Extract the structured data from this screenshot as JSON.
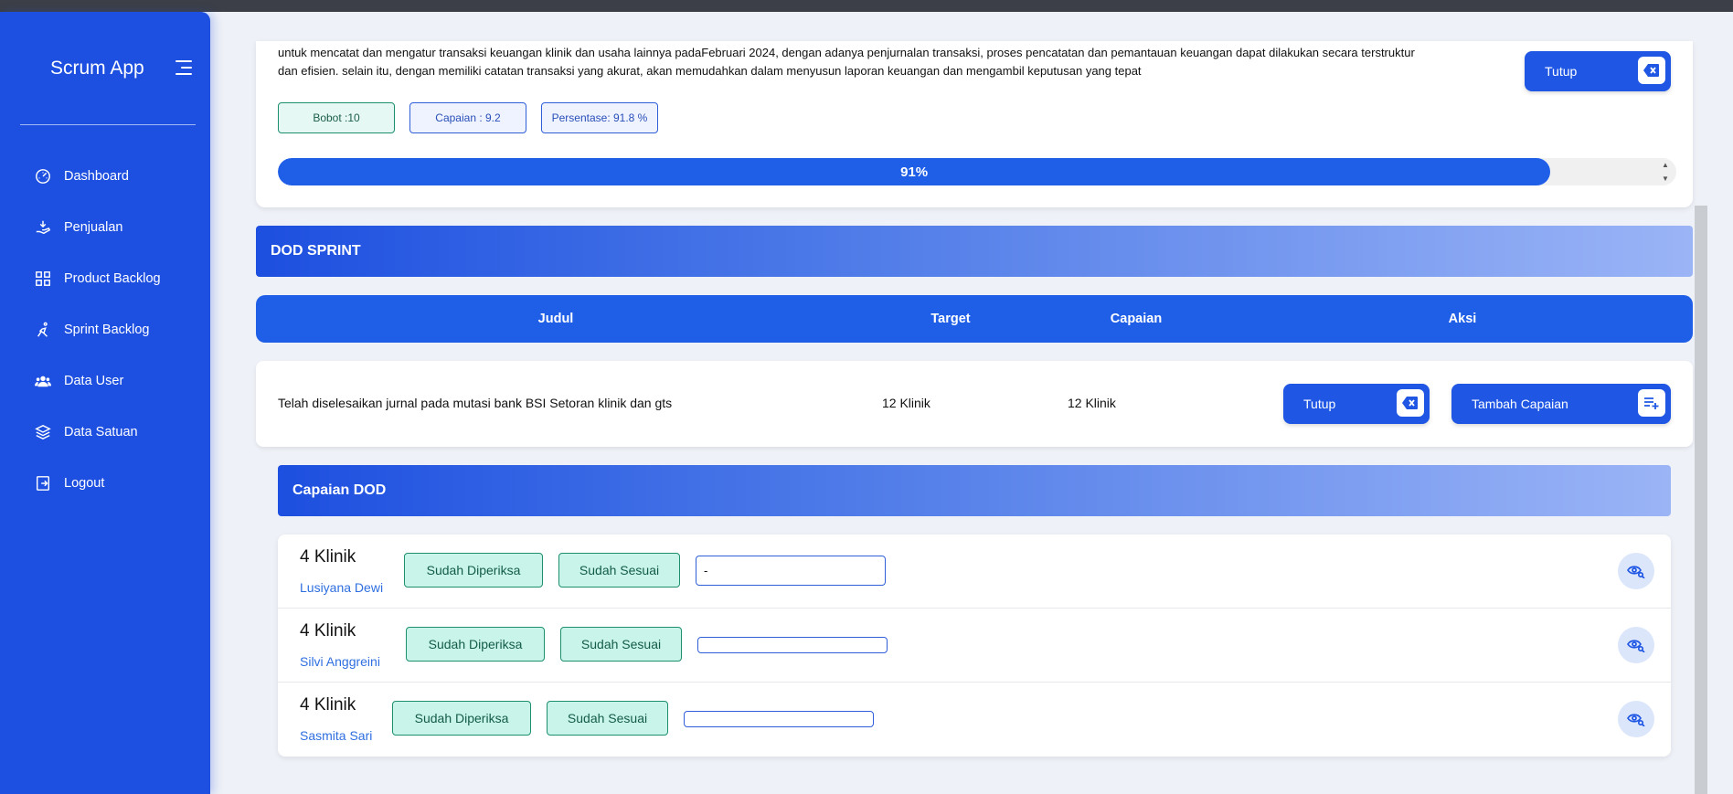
{
  "app": {
    "title": "Scrum App"
  },
  "sidebar": {
    "items": [
      {
        "label": "Dashboard",
        "icon": "gauge-icon"
      },
      {
        "label": "Penjualan",
        "icon": "hand-coin-icon"
      },
      {
        "label": "Product Backlog",
        "icon": "grid-icon"
      },
      {
        "label": "Sprint Backlog",
        "icon": "runner-icon"
      },
      {
        "label": "Data User",
        "icon": "users-icon"
      },
      {
        "label": "Data Satuan",
        "icon": "layers-icon"
      },
      {
        "label": "Logout",
        "icon": "logout-icon"
      }
    ]
  },
  "task": {
    "description": "untuk mencatat dan mengatur transaksi keuangan klinik dan usaha lainnya padaFebruari 2024, dengan adanya penjurnalan transaksi, proses pencatatan dan pemantauan keuangan dapat dilakukan secara terstruktur dan efisien. selain itu, dengan memiliki catatan transaksi yang akurat, akan memudahkan dalam menyusun laporan keuangan dan mengambil keputusan yang tepat",
    "close_label": "Tutup",
    "bobot": "Bobot :10",
    "capaian": "Capaian : 9.2",
    "persentase": "Persentase: 91.8 %",
    "progress_label": "91%",
    "progress_value": 0.91
  },
  "dod": {
    "title": "DOD SPRINT",
    "columns": {
      "judul": "Judul",
      "target": "Target",
      "capaian": "Capaian",
      "aksi": "Aksi"
    },
    "row": {
      "judul": "Telah diselesaikan jurnal pada mutasi bank BSI Setoran klinik dan gts",
      "target": "12 Klinik",
      "capaian": "12 Klinik",
      "close_label": "Tutup",
      "add_label": "Tambah Capaian"
    }
  },
  "capaian_dod": {
    "title": "Capaian DOD",
    "entries": [
      {
        "qty": "4 Klinik",
        "name": "Lusiyana Dewi",
        "status1": "Sudah Diperiksa",
        "status2": "Sudah Sesuai",
        "note": "-"
      },
      {
        "qty": "4 Klinik",
        "name": "Silvi Anggreini",
        "status1": "Sudah Diperiksa",
        "status2": "Sudah Sesuai",
        "note": ""
      },
      {
        "qty": "4 Klinik",
        "name": "Sasmita Sari",
        "status1": "Sudah Diperiksa",
        "status2": "Sudah Sesuai",
        "note": ""
      }
    ]
  },
  "colors": {
    "primary": "#1d4fe0",
    "accent": "#1f5fe8",
    "success_bg": "#c8f4e9",
    "success_border": "#1e8f6d"
  }
}
